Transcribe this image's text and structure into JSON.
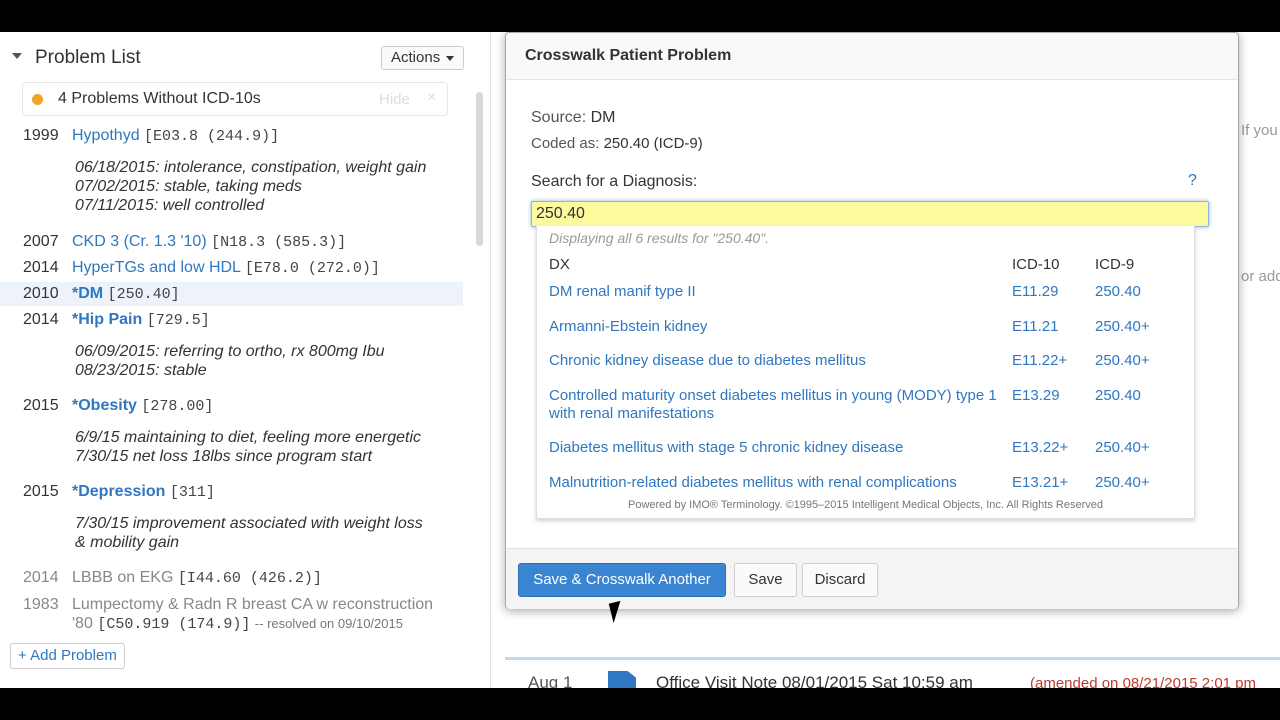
{
  "problem_list": {
    "title": "Problem List",
    "actions_label": "Actions",
    "warning": {
      "text": "4 Problems Without ICD-10s",
      "hide": "Hide",
      "close": "×"
    },
    "items": [
      {
        "year": "1999",
        "name": "Hypothyd",
        "codes": "[E03.8 (244.9)]",
        "notes": [
          "06/18/2015: intolerance, constipation, weight gain",
          "07/02/2015: stable, taking meds",
          "07/11/2015: well controlled"
        ]
      },
      {
        "year": "2007",
        "name": "CKD 3 (Cr. 1.3 '10)",
        "codes": "[N18.3 (585.3)]"
      },
      {
        "year": "2014",
        "name": "HyperTGs and low HDL",
        "codes": "[E78.0 (272.0)]"
      },
      {
        "year": "2010",
        "name": "*DM",
        "codes": "[250.40]"
      },
      {
        "year": "2014",
        "name": "*Hip Pain",
        "codes": "[729.5]",
        "notes": [
          "06/09/2015: referring to ortho, rx 800mg Ibu",
          "08/23/2015: stable"
        ]
      },
      {
        "year": "2015",
        "name": "*Obesity",
        "codes": "[278.00]",
        "notes": [
          "6/9/15 maintaining to diet, feeling more energetic",
          "7/30/15 net loss 18lbs since program start"
        ]
      },
      {
        "year": "2015",
        "name": "*Depression",
        "codes": "[311]",
        "notes": [
          "7/30/15 improvement associated with weight loss",
          "& mobility gain"
        ]
      },
      {
        "year": "2014",
        "name": "LBBB on EKG",
        "codes": "[I44.60 (426.2)]"
      },
      {
        "year": "1983",
        "name": "Lumpectomy & Radn R breast CA w reconstruction",
        "name2": "'80",
        "codes": "[C50.919 (174.9)]",
        "resolved": "-- resolved on 09/10/2015"
      }
    ],
    "add_label": "+ Add Problem"
  },
  "modal": {
    "title": "Crosswalk Patient Problem",
    "source_label": "Source:",
    "source_value": "DM",
    "coded_label": "Coded as:",
    "coded_value": "250.40 (ICD-9)",
    "search_label": "Search for a Diagnosis:",
    "help": "?",
    "search_value": "250.40",
    "results_info": "Displaying all 6 results for \"250.40\".",
    "columns": {
      "dx": "DX",
      "icd10": "ICD-10",
      "icd9": "ICD-9"
    },
    "results": [
      {
        "dx": "DM renal manif type II",
        "icd10": "E11.29",
        "icd9": "250.40"
      },
      {
        "dx": "Armanni-Ebstein kidney",
        "icd10": "E11.21",
        "icd9": "250.40+"
      },
      {
        "dx": "Chronic kidney disease due to diabetes mellitus",
        "icd10": "E11.22+",
        "icd9": "250.40+"
      },
      {
        "dx": "Controlled maturity onset diabetes mellitus in young (MODY) type 1 with renal manifestations",
        "icd10": "E13.29",
        "icd9": "250.40"
      },
      {
        "dx": "Diabetes mellitus with stage 5 chronic kidney disease",
        "icd10": "E13.22+",
        "icd9": "250.40+"
      },
      {
        "dx": "Malnutrition-related diabetes mellitus with renal complications",
        "icd10": "E13.21+",
        "icd9": "250.40+"
      }
    ],
    "footer_note": "Powered by IMO® Terminology. ©1995–2015 Intelligent Medical Objects, Inc. All Rights Reserved",
    "buttons": {
      "save_another": "Save & Crosswalk Another",
      "save": "Save",
      "discard": "Discard"
    }
  },
  "background": {
    "visit_date": "Aug 1",
    "visit_title": "Office Visit Note 08/01/2015 Sat 10:59 am",
    "amended": "(amended on 08/21/2015 2:01 pm",
    "snip1": "If you",
    "snip2": "or add"
  },
  "colors": {
    "link": "#2f77c0",
    "primary": "#3a85d1",
    "warning_dot": "#f0a428",
    "search_bg": "#fdfa9e"
  }
}
